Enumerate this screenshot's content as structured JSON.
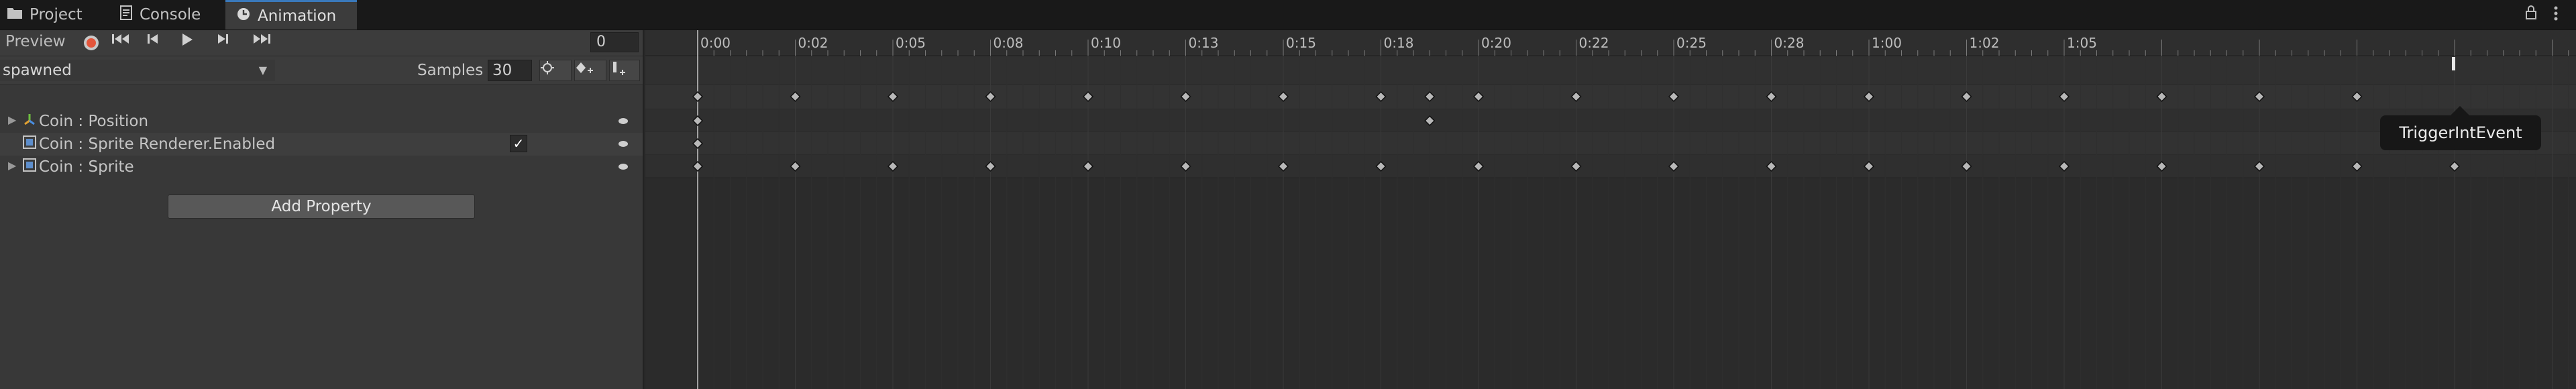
{
  "tabs": [
    {
      "label": "Project",
      "icon": "folder-icon"
    },
    {
      "label": "Console",
      "icon": "console-icon"
    },
    {
      "label": "Animation",
      "icon": "clock-icon",
      "active": true
    }
  ],
  "toolbar": {
    "preview_label": "Preview",
    "frame_value": "0"
  },
  "clip": {
    "selected": "spawned",
    "samples_label": "Samples",
    "samples_value": "30"
  },
  "properties": [
    {
      "label": "Coin : Position",
      "icon": "transform-icon",
      "foldout": true
    },
    {
      "label": "Coin : Sprite Renderer.Enabled",
      "icon": "component-icon",
      "foldout": false,
      "checked": true
    },
    {
      "label": "Coin : Sprite",
      "icon": "component-icon",
      "foldout": true
    }
  ],
  "add_property_label": "Add Property",
  "ruler": {
    "labels": [
      "0:00",
      "0:02",
      "0:05",
      "0:08",
      "0:10",
      "0:13",
      "0:15",
      "0:18",
      "0:20",
      "0:22",
      "0:25",
      "0:28",
      "1:00",
      "1:02",
      "1:05"
    ]
  },
  "tooltip_text": "TriggerIntEvent",
  "keyframes": {
    "summary_frames": [
      0,
      6,
      12,
      18,
      24,
      30,
      36,
      42,
      45,
      48,
      54,
      60,
      66,
      72,
      78,
      84,
      90,
      96,
      102
    ],
    "position_frames": [
      0,
      45
    ],
    "enabled_frames": [
      0
    ],
    "sprite_frames": [
      0,
      6,
      12,
      18,
      24,
      30,
      36,
      42,
      48,
      54,
      60,
      66,
      72,
      78,
      84,
      90,
      96,
      102,
      108
    ]
  },
  "event_frame": 108,
  "colors": {
    "accent": "#3a79bb",
    "record": "#e4553b",
    "keyframe": "#b8b8b8",
    "background": "#2b2b2b"
  }
}
